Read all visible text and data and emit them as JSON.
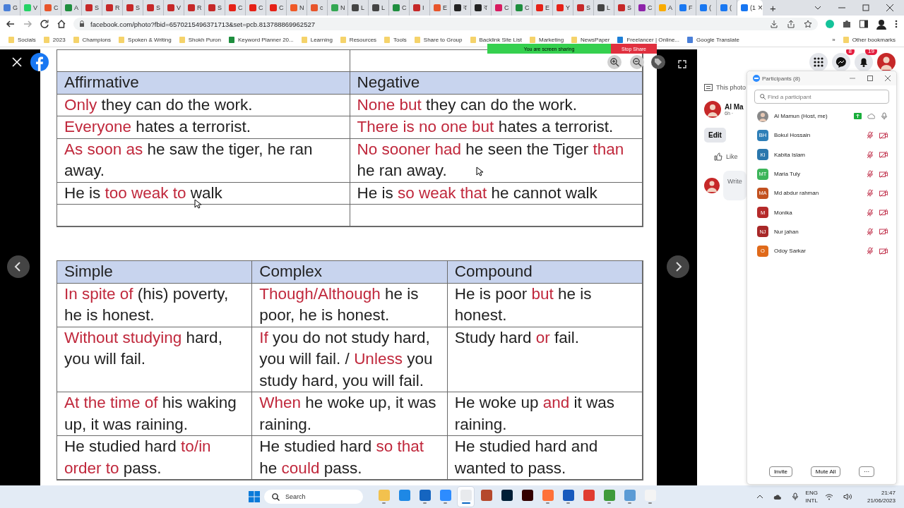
{
  "browser": {
    "tabs": [
      {
        "label": "G",
        "color": "#4a7fd8",
        "selected": false
      },
      {
        "label": "V",
        "color": "#25d366",
        "selected": false
      },
      {
        "label": "C",
        "color": "#e8552b",
        "selected": false
      },
      {
        "label": "A",
        "color": "#1e8e3e",
        "selected": false
      },
      {
        "label": "S",
        "color": "#c62828",
        "selected": false
      },
      {
        "label": "R",
        "color": "#c62828",
        "selected": false
      },
      {
        "label": "S",
        "color": "#c62828",
        "selected": false
      },
      {
        "label": "S",
        "color": "#c62828",
        "selected": false
      },
      {
        "label": "V",
        "color": "#c62828",
        "selected": false
      },
      {
        "label": "R",
        "color": "#c62828",
        "selected": false
      },
      {
        "label": "S",
        "color": "#c62828",
        "selected": false
      },
      {
        "label": "C",
        "color": "#e62117",
        "selected": false
      },
      {
        "label": "C",
        "color": "#e62117",
        "selected": false
      },
      {
        "label": "C",
        "color": "#e62117",
        "selected": false
      },
      {
        "label": "N",
        "color": "#f05a28",
        "selected": false
      },
      {
        "label": "c",
        "color": "#e8552b",
        "selected": false
      },
      {
        "label": "N",
        "color": "#34a853",
        "selected": false
      },
      {
        "label": "L",
        "color": "#444444",
        "selected": false
      },
      {
        "label": "L",
        "color": "#444444",
        "selected": false
      },
      {
        "label": "C",
        "color": "#1e8e3e",
        "selected": false
      },
      {
        "label": "I",
        "color": "#c62828",
        "selected": false
      },
      {
        "label": "E",
        "color": "#e8552b",
        "selected": false
      },
      {
        "label": "ব",
        "color": "#222222",
        "selected": false
      },
      {
        "label": "ব",
        "color": "#222222",
        "selected": false
      },
      {
        "label": "C",
        "color": "#d81b60",
        "selected": false
      },
      {
        "label": "C",
        "color": "#1e8e3e",
        "selected": false
      },
      {
        "label": "E",
        "color": "#e62117",
        "selected": false
      },
      {
        "label": "Y",
        "color": "#e62117",
        "selected": false
      },
      {
        "label": "S",
        "color": "#c62828",
        "selected": false
      },
      {
        "label": "L",
        "color": "#444444",
        "selected": false
      },
      {
        "label": "S",
        "color": "#c62828",
        "selected": false
      },
      {
        "label": "C",
        "color": "#8e24aa",
        "selected": false
      },
      {
        "label": "A",
        "color": "#f9ab00",
        "selected": false
      },
      {
        "label": "F",
        "color": "#1877f2",
        "selected": false
      },
      {
        "label": "(",
        "color": "#1877f2",
        "selected": false
      },
      {
        "label": "(",
        "color": "#1877f2",
        "selected": false
      },
      {
        "label": "(1",
        "color": "#1877f2",
        "selected": true
      }
    ],
    "close_tab": "×",
    "new_tab": "+",
    "address": "facebook.com/photo?fbid=6570215496371713&set=pcb.813788869962527",
    "bookmarks": [
      {
        "label": "Socials",
        "kind": "folder"
      },
      {
        "label": "2023",
        "kind": "folder"
      },
      {
        "label": "Champions",
        "kind": "folder"
      },
      {
        "label": "Spoken & Writing",
        "kind": "folder"
      },
      {
        "label": "Shokh Puron",
        "kind": "folder"
      },
      {
        "label": "Keyword Planner 20...",
        "kind": "sheet"
      },
      {
        "label": "Learning",
        "kind": "folder"
      },
      {
        "label": "Resources",
        "kind": "folder"
      },
      {
        "label": "Tools",
        "kind": "folder"
      },
      {
        "label": "Share to Group",
        "kind": "folder"
      },
      {
        "label": "Backlink Site List",
        "kind": "folder"
      },
      {
        "label": "Marketing",
        "kind": "folder"
      },
      {
        "label": "NewsPaper",
        "kind": "folder"
      },
      {
        "label": "Freelancer | Online...",
        "kind": "site"
      },
      {
        "label": "Google Translate",
        "kind": "translate"
      }
    ],
    "more_bookmarks": "»",
    "other_bookmarks": "Other bookmarks"
  },
  "share_banner": {
    "text": "You are screen sharing",
    "stop": "Stop Share"
  },
  "photo": {
    "tables": [
      {
        "leading_blank_row": true,
        "trailing_blank_row": true,
        "columns": [
          "Affirmative",
          "Negative"
        ],
        "rows": [
          [
            [
              {
                "text": "Only",
                "highlight": true
              },
              {
                "text": " they can do the work.",
                "highlight": false
              }
            ],
            [
              {
                "text": "None but",
                "highlight": true
              },
              {
                "text": " they can do the work.",
                "highlight": false
              }
            ]
          ],
          [
            [
              {
                "text": "Everyone",
                "highlight": true
              },
              {
                "text": " hates a terrorist.",
                "highlight": false
              }
            ],
            [
              {
                "text": "There is no one but",
                "highlight": true
              },
              {
                "text": " hates a terrorist.",
                "highlight": false
              }
            ]
          ],
          [
            [
              {
                "text": "As soon as",
                "highlight": true
              },
              {
                "text": " he saw the tiger, he ran away.",
                "highlight": false
              }
            ],
            [
              {
                "text": "No sooner had",
                "highlight": true
              },
              {
                "text": " he seen the Tiger ",
                "highlight": false
              },
              {
                "text": "than",
                "highlight": true
              },
              {
                "text": " he ran away.",
                "highlight": false
              }
            ]
          ],
          [
            [
              {
                "text": "He is ",
                "highlight": false
              },
              {
                "text": "too weak to",
                "highlight": true
              },
              {
                "text": " walk",
                "highlight": false
              }
            ],
            [
              {
                "text": "He is ",
                "highlight": false
              },
              {
                "text": "so weak that",
                "highlight": true
              },
              {
                "text": " he cannot walk",
                "highlight": false
              }
            ]
          ]
        ]
      },
      {
        "columns": [
          "Simple",
          "Complex",
          "Compound"
        ],
        "rows": [
          [
            [
              {
                "text": "In spite of",
                "highlight": true
              },
              {
                "text": " (his) poverty, he is honest.",
                "highlight": false
              }
            ],
            [
              {
                "text": "Though/Although",
                "highlight": true
              },
              {
                "text": " he is poor, he is honest.",
                "highlight": false
              }
            ],
            [
              {
                "text": "He is poor ",
                "highlight": false
              },
              {
                "text": "but",
                "highlight": true
              },
              {
                "text": " he is honest.",
                "highlight": false
              }
            ]
          ],
          [
            [
              {
                "text": "Without studying",
                "highlight": true
              },
              {
                "text": " hard, you will fail.",
                "highlight": false
              }
            ],
            [
              {
                "text": "If",
                "highlight": true
              },
              {
                "text": " you do not study hard, you will fail. / ",
                "highlight": false
              },
              {
                "text": "Unless",
                "highlight": true
              },
              {
                "text": " you study hard, you will fail.",
                "highlight": false
              }
            ],
            [
              {
                "text": "Study hard ",
                "highlight": false
              },
              {
                "text": "or",
                "highlight": true
              },
              {
                "text": " fail.",
                "highlight": false
              }
            ]
          ],
          [
            [
              {
                "text": "At the time of",
                "highlight": true
              },
              {
                "text": " his waking up, it was raining.",
                "highlight": false
              }
            ],
            [
              {
                "text": "When",
                "highlight": true
              },
              {
                "text": " he woke up, it was raining.",
                "highlight": false
              }
            ],
            [
              {
                "text": "He woke up ",
                "highlight": false
              },
              {
                "text": "and",
                "highlight": true
              },
              {
                "text": " it was raining.",
                "highlight": false
              }
            ]
          ],
          [
            [
              {
                "text": "He studied hard ",
                "highlight": false
              },
              {
                "text": "to/in order to",
                "highlight": true
              },
              {
                "text": " pass.",
                "highlight": false
              }
            ],
            [
              {
                "text": "He studied hard ",
                "highlight": false
              },
              {
                "text": "so that",
                "highlight": true
              },
              {
                "text": " he ",
                "highlight": false
              },
              {
                "text": "could",
                "highlight": true
              },
              {
                "text": " pass.",
                "highlight": false
              }
            ],
            [
              {
                "text": "He studied hard and wanted to pass.",
                "highlight": false
              }
            ]
          ]
        ]
      }
    ]
  },
  "facebook": {
    "messenger_badge": "8",
    "notifications_badge": "19",
    "info": "This photo",
    "author": "Al Ma",
    "time": "6h ·",
    "edit": "Edit",
    "like": "Like",
    "comment_placeholder": "Write"
  },
  "participants": {
    "title": "Participants (8)",
    "search_placeholder": "Find a participant",
    "people": [
      {
        "name": "Al Mamun (Host, me)",
        "color": "#888888",
        "host": true,
        "muted": false
      },
      {
        "name": "Bokul Hossain",
        "initials": "BH",
        "color": "#2e7fb8",
        "host": false,
        "muted": true
      },
      {
        "name": "Kabita Islam",
        "initials": "KI",
        "color": "#2a77ad",
        "host": false,
        "muted": true
      },
      {
        "name": "Maria Tuly",
        "initials": "MT",
        "color": "#3cb55a",
        "host": false,
        "muted": true
      },
      {
        "name": "Md abdur rahman",
        "initials": "MA",
        "color": "#c2511f",
        "host": false,
        "muted": true
      },
      {
        "name": "Monika",
        "initials": "M",
        "color": "#b52a2a",
        "host": false,
        "muted": true
      },
      {
        "name": "Nur jahan",
        "initials": "NJ",
        "color": "#a82828",
        "host": false,
        "muted": true
      },
      {
        "name": "Odoy Sarkar",
        "initials": "O",
        "color": "#e06a1a",
        "host": false,
        "muted": true
      }
    ],
    "buttons": [
      "Invite",
      "Mute All",
      "···"
    ]
  },
  "taskbar": {
    "search": "Search",
    "apps": [
      {
        "running": true,
        "active": false
      },
      {
        "running": false,
        "active": false
      },
      {
        "running": true,
        "active": false
      },
      {
        "running": true,
        "active": false
      },
      {
        "running": true,
        "active": true
      },
      {
        "running": false,
        "active": false
      },
      {
        "running": false,
        "active": false
      },
      {
        "running": false,
        "active": false
      },
      {
        "running": true,
        "active": false
      },
      {
        "running": true,
        "active": false
      },
      {
        "running": false,
        "active": false
      },
      {
        "running": true,
        "active": false
      },
      {
        "running": true,
        "active": false
      },
      {
        "running": true,
        "active": false
      }
    ],
    "language": "ENG",
    "layout": "INTL",
    "time": "21:47",
    "date": "21/06/2023"
  }
}
